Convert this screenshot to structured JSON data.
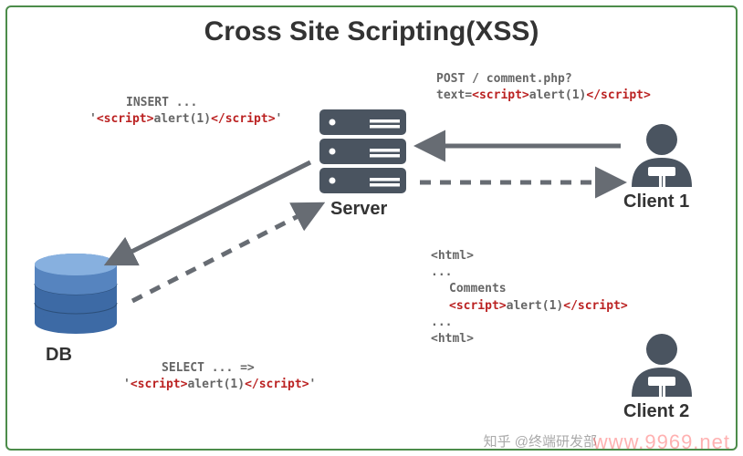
{
  "title": "Cross Site Scripting(XSS)",
  "nodes": {
    "server": "Server",
    "db": "DB",
    "client1": "Client 1",
    "client2": "Client 2"
  },
  "insert": {
    "line1": "INSERT ...",
    "quote_open": "'",
    "script_open": "<script>",
    "script_body": "alert(1)",
    "script_close": "</script>",
    "quote_close": "'"
  },
  "select": {
    "line1": "SELECT ... =>",
    "quote_open": "'",
    "script_open": "<script>",
    "script_body": "alert(1)",
    "script_close": "</script>",
    "quote_close": "'"
  },
  "post": {
    "line1": "POST / comment.php?",
    "prefix": "text=",
    "script_open": "<script>",
    "script_body": "alert(1)",
    "script_close": "</script>"
  },
  "response": {
    "html_open": "<html>",
    "dots1": "...",
    "comments": "Comments",
    "script_open": "<script>",
    "script_body": "alert(1)",
    "script_close": "</script>",
    "dots2": "...",
    "html_close": "<html>"
  },
  "watermark1": "知乎 @终端研发部",
  "watermark2": "www.9969.net"
}
